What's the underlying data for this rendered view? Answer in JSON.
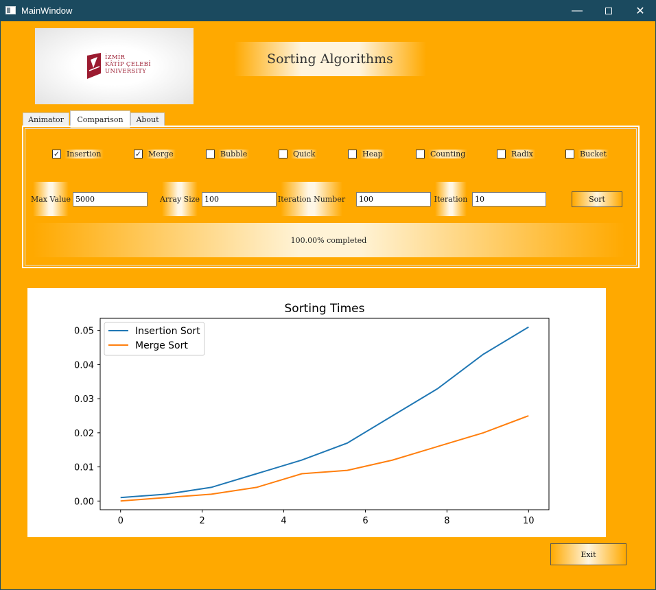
{
  "window": {
    "title": "MainWindow",
    "minimize_glyph": "—",
    "close_glyph": "✕"
  },
  "logo": {
    "lines": [
      "İZMİR",
      "KÂTİP ÇELEBİ",
      "UNIVERSITY"
    ],
    "color": "#9b1b30"
  },
  "header": {
    "title": "Sorting Algorithms"
  },
  "tabs": [
    {
      "label": "Animator",
      "active": false
    },
    {
      "label": "Comparison",
      "active": true
    },
    {
      "label": "About",
      "active": false
    }
  ],
  "algorithms": [
    {
      "label": "Insertion",
      "checked": true
    },
    {
      "label": "Merge",
      "checked": true
    },
    {
      "label": "Bubble",
      "checked": false
    },
    {
      "label": "Quick",
      "checked": false
    },
    {
      "label": "Heap",
      "checked": false
    },
    {
      "label": "Counting",
      "checked": false
    },
    {
      "label": "Radix",
      "checked": false
    },
    {
      "label": "Bucket",
      "checked": false
    }
  ],
  "check_glyph": "✓",
  "fields": {
    "max_value": {
      "label": "Max Value",
      "value": "5000"
    },
    "array_size": {
      "label": "Array Size",
      "value": "100"
    },
    "iteration_number": {
      "label": "Iteration Number",
      "value": "100"
    },
    "iteration": {
      "label": "Iteration",
      "value": "10"
    }
  },
  "sort_button": "Sort",
  "progress_text": "100.00% completed",
  "exit_button": "Exit",
  "colors": {
    "background": "#ffa900",
    "titlebar": "#1b4a5f",
    "insertion": "#1f77b4",
    "merge": "#ff7f0e"
  },
  "chart_data": {
    "type": "line",
    "title": "Sorting Times",
    "xlabel": "",
    "ylabel": "",
    "x": [
      0,
      1.111,
      2.222,
      3.333,
      4.444,
      5.556,
      6.667,
      7.778,
      8.889,
      10
    ],
    "series": [
      {
        "name": "Insertion Sort",
        "color": "#1f77b4",
        "values": [
          0.001,
          0.002,
          0.004,
          0.008,
          0.012,
          0.017,
          0.025,
          0.033,
          0.043,
          0.051
        ]
      },
      {
        "name": "Merge Sort",
        "color": "#ff7f0e",
        "values": [
          0.0,
          0.001,
          0.002,
          0.004,
          0.008,
          0.009,
          0.012,
          0.016,
          0.02,
          0.025
        ]
      }
    ],
    "xticks": [
      0,
      2,
      4,
      6,
      8,
      10
    ],
    "xtick_labels": [
      "0",
      "2",
      "4",
      "6",
      "8",
      "10"
    ],
    "yticks": [
      0.0,
      0.01,
      0.02,
      0.03,
      0.04,
      0.05
    ],
    "ytick_labels": [
      "0.00",
      "0.01",
      "0.02",
      "0.03",
      "0.04",
      "0.05"
    ],
    "xlim": [
      -0.5,
      10.5
    ],
    "ylim": [
      -0.00255,
      0.05355
    ],
    "grid": false,
    "legend": "upper-left"
  }
}
